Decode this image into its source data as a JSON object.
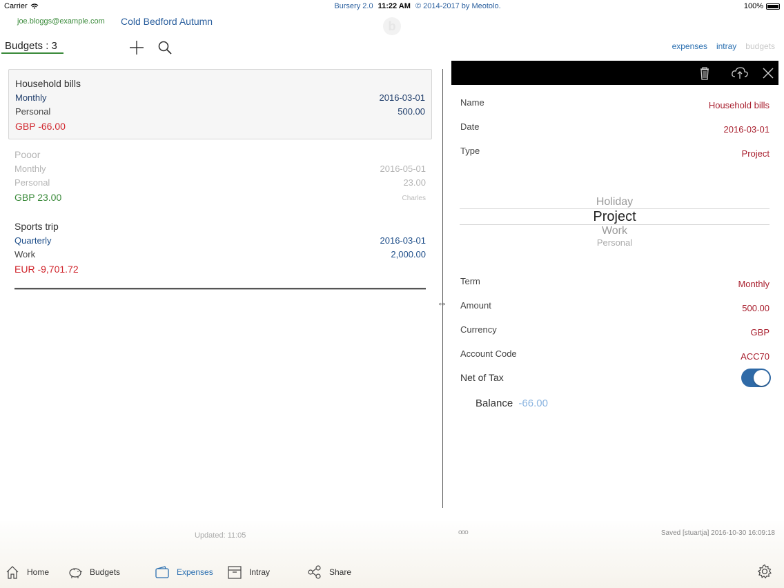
{
  "status_bar": {
    "carrier": "Carrier",
    "app_name": "Bursery 2.0",
    "time": "11:22 AM",
    "copyright": "© 2014-2017 by Meotolo.",
    "battery": "100%"
  },
  "header": {
    "user_email": "joe.bloggs@example.com",
    "list_name": "Cold Bedford Autumn",
    "logo_letter": "b",
    "budgets_count": "Budgets : 3",
    "nav": [
      "expenses",
      "intray",
      "budgets"
    ]
  },
  "budgets": [
    {
      "name": "Household bills",
      "term": "Monthly",
      "date": "2016-03-01",
      "type": "Personal",
      "amount": "500.00",
      "balance": "GBP -66.00",
      "owner": ""
    },
    {
      "name": "Pooor",
      "term": "Monthly",
      "date": "2016-05-01",
      "type": "Personal",
      "amount": "23.00",
      "balance": "GBP 23.00",
      "owner": "Charles"
    },
    {
      "name": "Sports trip",
      "term": "Quarterly",
      "date": "2016-03-01",
      "type": "Work",
      "amount": "2,000.00",
      "balance": "EUR -9,701.72",
      "owner": ""
    }
  ],
  "detail": {
    "fields": {
      "name": {
        "label": "Name",
        "value": "Household bills"
      },
      "date": {
        "label": "Date",
        "value": "2016-03-01"
      },
      "type": {
        "label": "Type",
        "value": "Project"
      },
      "term": {
        "label": "Term",
        "value": "Monthly"
      },
      "amount": {
        "label": "Amount",
        "value": "500.00"
      },
      "currency": {
        "label": "Currency",
        "value": "GBP"
      },
      "account_code": {
        "label": "Account Code",
        "value": "ACC70"
      }
    },
    "picker_options": [
      "Holiday",
      "Project",
      "Work",
      "Personal"
    ],
    "picker_selected": "Project",
    "net_of_tax_label": "Net of Tax",
    "net_of_tax_on": true,
    "balance_label": "Balance",
    "balance_value": "-66.00"
  },
  "footer": {
    "updated": "Updated: 11:05",
    "dots": "ooo",
    "saved": "Saved [stuartja] 2016-10-30 16:09:18",
    "tabs": [
      "Home",
      "Budgets",
      "Expenses",
      "Intray",
      "Share"
    ],
    "active_tab": "Expenses"
  },
  "colors": {
    "accent": "#2a6fb0",
    "negative": "#d0242b",
    "positive": "#3a8a3a",
    "detail_value": "#a81e2d",
    "toggle_on": "#2f6aa7"
  },
  "icons": [
    "wifi-icon",
    "battery-icon",
    "plus-icon",
    "search-icon",
    "trash-icon",
    "cloud-upload-icon",
    "close-icon",
    "resize-icon",
    "home-icon",
    "piggy-bank-icon",
    "wallet-icon",
    "inbox-icon",
    "share-icon",
    "gear-icon"
  ]
}
